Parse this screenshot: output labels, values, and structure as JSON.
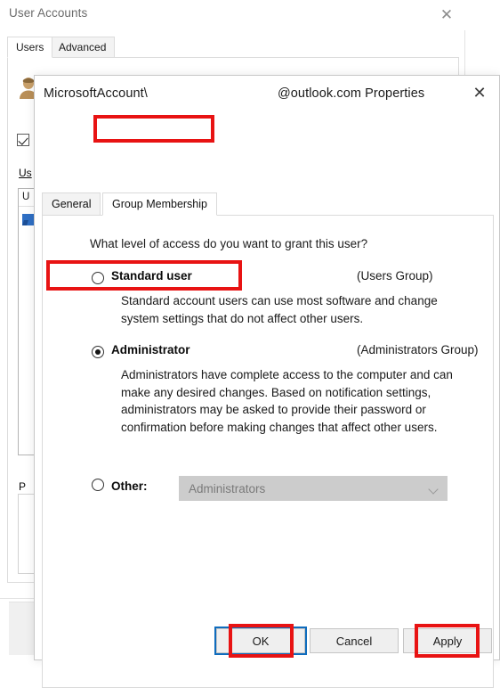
{
  "background_window": {
    "title": "User Accounts",
    "close_icon": "close-icon",
    "tabs": [
      {
        "label": "Users",
        "active": true
      },
      {
        "label": "Advanced",
        "active": false
      }
    ],
    "checkbox_label_fragment": "Us",
    "list_header_fragment": "U",
    "password_label_fragment": "P"
  },
  "dialog": {
    "title_prefix": "MicrosoftAccount\\",
    "title_suffix": "@outlook.com Properties",
    "close_icon": "close-icon",
    "tabs": [
      {
        "label": "General",
        "active": false
      },
      {
        "label": "Group Membership",
        "active": true
      }
    ],
    "prompt": "What level of access do you want to grant this user?",
    "options": [
      {
        "label": "Standard user",
        "group": "(Users Group)",
        "selected": false,
        "description": "Standard account users can use most software and change system settings that do not affect other users."
      },
      {
        "label": "Administrator",
        "group": "(Administrators Group)",
        "selected": true,
        "description": "Administrators have complete access to the computer and can make any desired changes. Based on notification settings, administrators may be asked to provide their password or confirmation before making changes that affect other users."
      }
    ],
    "other": {
      "label": "Other:",
      "selected": false,
      "combo_value": "Administrators",
      "combo_disabled": true,
      "combo_arrow_icon": "chevron-down-icon"
    },
    "buttons": {
      "ok": "OK",
      "cancel": "Cancel",
      "apply": "Apply"
    }
  },
  "annotations": {
    "color": "#e81313",
    "focus_color": "#0f6cbd",
    "targets": [
      "Group Membership",
      "Administrator",
      "OK",
      "Apply"
    ]
  }
}
